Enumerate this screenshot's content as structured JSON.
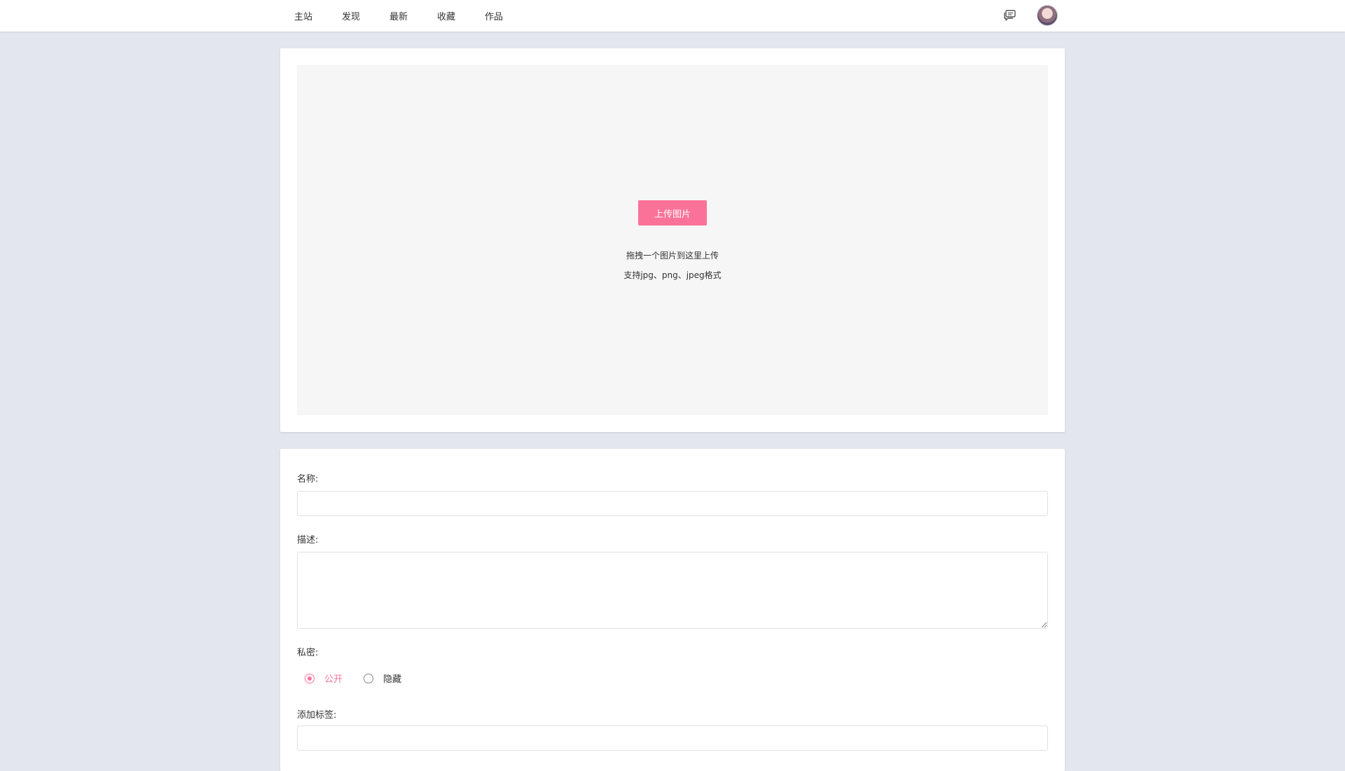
{
  "nav": {
    "items": [
      {
        "label": "主站"
      },
      {
        "label": "发现"
      },
      {
        "label": "最新"
      },
      {
        "label": "收藏"
      },
      {
        "label": "作品"
      }
    ],
    "message_icon": "chat-bubbles-icon",
    "avatar_icon": "user-avatar"
  },
  "upload": {
    "button_label": "上传图片",
    "hint_line1": "拖拽一个图片到这里上传",
    "hint_line2": "支持jpg、png、jpeg格式"
  },
  "form": {
    "name_label": "名称:",
    "name_value": "",
    "description_label": "描述:",
    "description_value": "",
    "privacy_label": "私密:",
    "privacy_options": [
      {
        "label": "公开",
        "selected": true
      },
      {
        "label": "隐藏",
        "selected": false
      }
    ],
    "tags_label": "添加标签:",
    "tags_value": ""
  },
  "colors": {
    "accent": "#fb7299",
    "background": "#e3e6ee",
    "card": "#ffffff",
    "dropzone": "#f6f6f6"
  }
}
